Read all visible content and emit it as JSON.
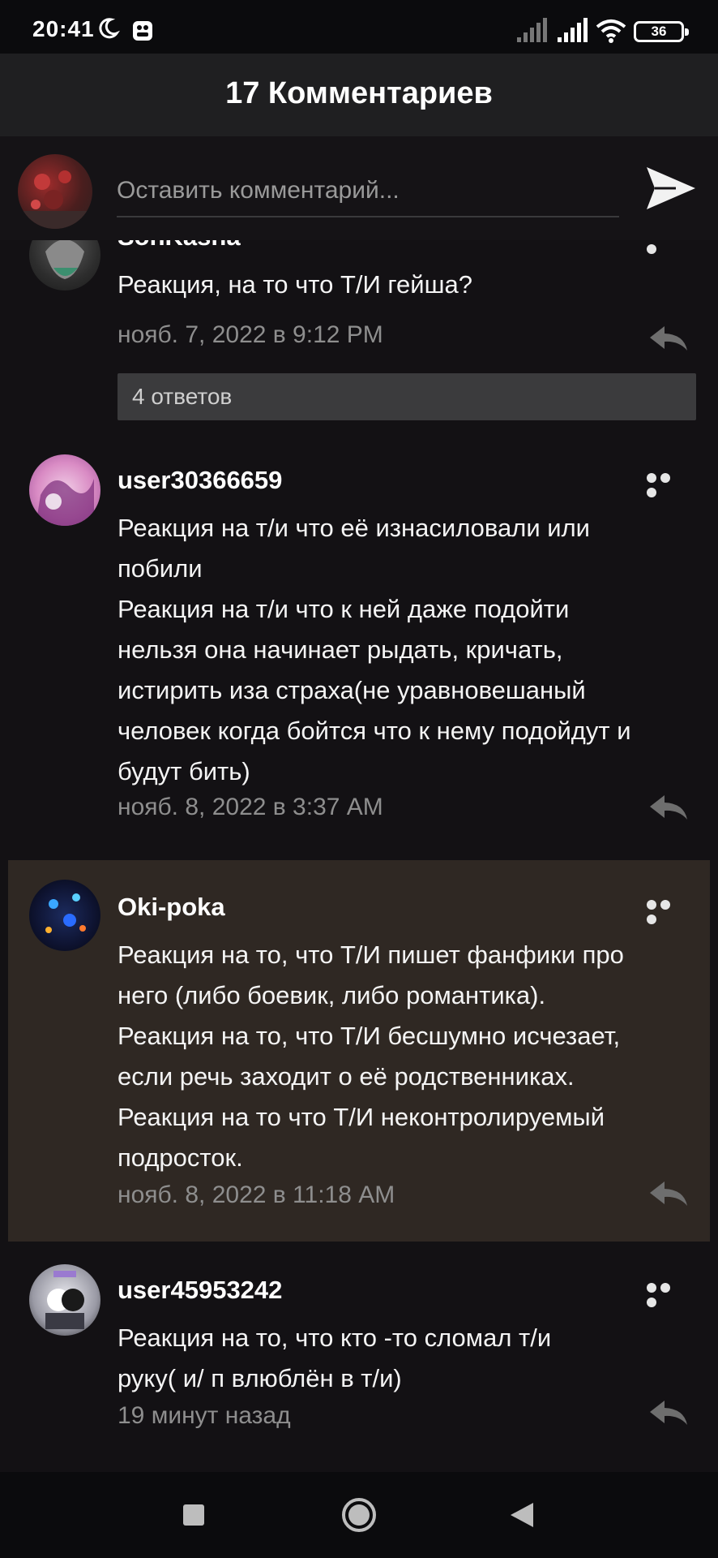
{
  "status_bar": {
    "time": "20:41",
    "battery": "36",
    "icons": [
      "moon-icon",
      "app-notification-icon",
      "signal-icon",
      "signal-icon",
      "wifi-icon",
      "battery-icon"
    ]
  },
  "header": {
    "title": "17 Комментариев"
  },
  "composer": {
    "placeholder": "Оставить комментарий...",
    "send_icon": "send-icon"
  },
  "comments": [
    {
      "user": "SonKasha",
      "text": "Реакция, на то что Т/И гейша?",
      "date": "нояб. 7, 2022 в 9:12 PM",
      "replies_label": "4 ответов"
    },
    {
      "user": "user30366659",
      "text": "Реакция на т/и что её изнасиловали или\nпобили\nРеакция на т/и что к ней даже подойти\nнельзя она начинает рыдать, кричать,\nистирить иза страха(не уравновешаный\nчеловек когда бойтся что к нему подойдут и\nбудут бить)",
      "date": "нояб. 8, 2022 в 3:37 AM"
    },
    {
      "user": "Oki-poka",
      "text": "Реакция на то, что Т/И пишет фанфики про\nнего (либо боевик, либо романтика).\nРеакция на то, что Т/И  бесшумно исчезает,\nесли речь заходит о её родственниках.\nРеакция на то что Т/И неконтролируемый\nподросток.",
      "date": "нояб. 8, 2022 в 11:18 AM",
      "highlighted": true
    },
    {
      "user": "user45953242",
      "text": "Реакция на то, что кто -то сломал т/и\nруку( и/ п влюблён в т/и)",
      "date": "19 минут назад"
    }
  ],
  "colors": {
    "background": "#131114",
    "header": "#1f1f21",
    "highlight": "#2f2823",
    "date_text": "#8e8e8e",
    "replies_button": "#3b3b3d"
  },
  "navigation": {
    "icons": [
      "recent-apps-icon",
      "home-icon",
      "back-icon"
    ]
  }
}
